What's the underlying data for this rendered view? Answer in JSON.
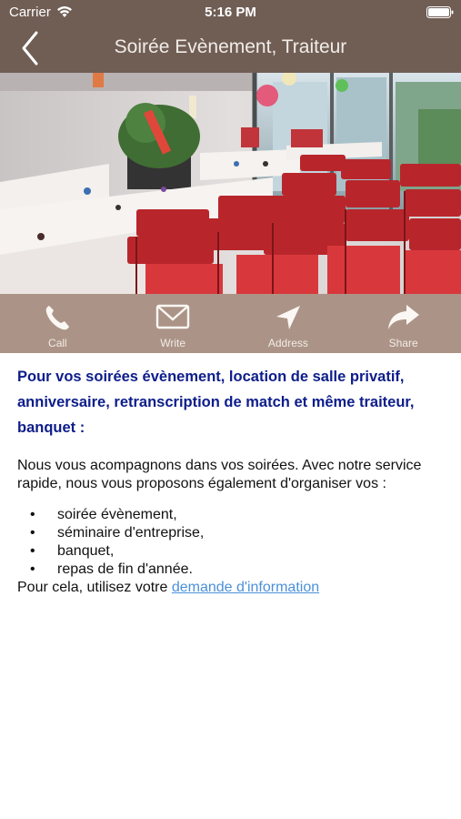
{
  "status_bar": {
    "carrier": "Carrier",
    "time": "5:16 PM",
    "wifi_icon": "wifi-icon",
    "battery_icon": "battery-icon"
  },
  "nav": {
    "title": "Soirée Evènement, Traiteur",
    "back_icon": "chevron-left-icon",
    "background": "#705e55"
  },
  "actions": [
    {
      "label": "Call",
      "icon": "phone-icon"
    },
    {
      "label": "Write",
      "icon": "envelope-icon"
    },
    {
      "label": "Address",
      "icon": "location-arrow-icon"
    },
    {
      "label": "Share",
      "icon": "share-arrow-icon"
    }
  ],
  "action_bar_color": "#ab9487",
  "content": {
    "headline": "Pour vos soirées évènement, location de salle privatif, anniversaire, retranscription de match et même traiteur, banquet :",
    "intro": "Nous vous acompagnons dans vos soirées. Avec notre service rapide, nous vous proposons également d'organiser vos :",
    "bullets": [
      "soirée évènement,",
      "séminaire d'entreprise,",
      "banquet,",
      "repas de fin d'année."
    ],
    "footer_text": "Pour cela, utilisez votre ",
    "link_text": "demande d'information",
    "headline_color": "#0d1d8a",
    "link_color": "#4a90d9"
  }
}
